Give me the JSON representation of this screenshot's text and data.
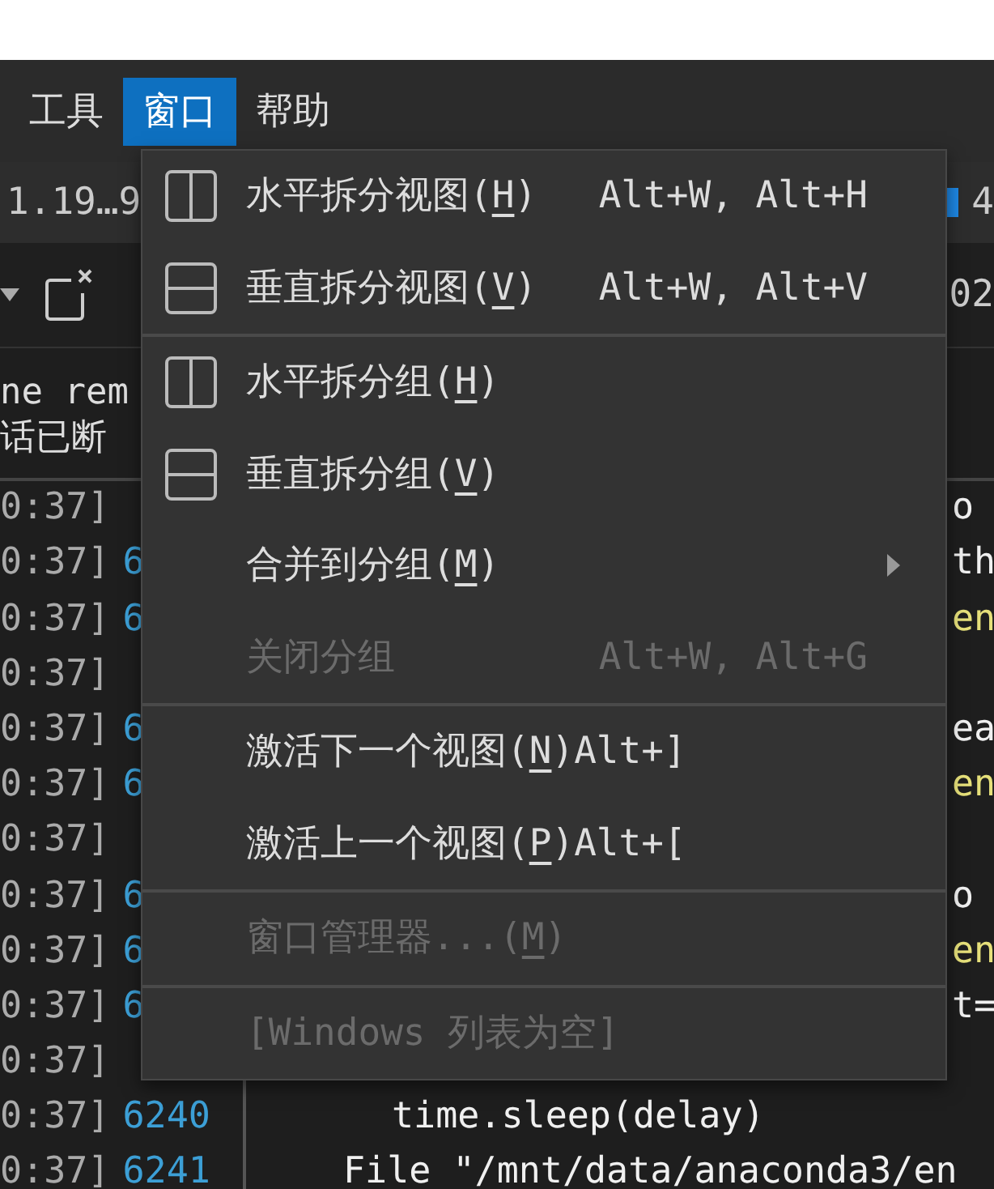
{
  "menubar": [
    {
      "label": "工具",
      "selected": false
    },
    {
      "label": "窗口",
      "selected": true
    },
    {
      "label": "帮助",
      "selected": false
    }
  ],
  "tab_bar": {
    "tab_text": "1.19…9",
    "right_text": "4"
  },
  "toolbar": {
    "right_text": "02"
  },
  "session_messages": [
    "ne rem",
    "话已断"
  ],
  "log_rows": [
    {
      "time": "0:37]"
    },
    {
      "time": "0:37]",
      "number": "6"
    },
    {
      "time": "0:37]",
      "number": "6"
    },
    {
      "time": "0:37]"
    },
    {
      "time": "0:37]",
      "number": "6"
    },
    {
      "time": "0:37]",
      "number": "6"
    },
    {
      "time": "0:37]"
    },
    {
      "time": "0:37]",
      "number": "6"
    },
    {
      "time": "0:37]",
      "number": "6"
    },
    {
      "time": "0:37]",
      "number": "6"
    },
    {
      "time": "0:37]"
    },
    {
      "time": "0:37]",
      "number": "6240"
    },
    {
      "time": "0:37]",
      "number": "6241"
    }
  ],
  "code_lines": [
    {
      "kind": "tail",
      "text": "o"
    },
    {
      "kind": "tail",
      "text": "th"
    },
    {
      "kind": "tailstring",
      "text": "en"
    },
    {
      "kind": "blank"
    },
    {
      "kind": "tail",
      "text": "ea"
    },
    {
      "kind": "tailstring",
      "text": "en"
    },
    {
      "kind": "blank"
    },
    {
      "kind": "tail",
      "text": "o"
    },
    {
      "kind": "tailstring",
      "text": "en"
    },
    {
      "kind": "tail",
      "text": "t="
    },
    {
      "kind": "blank"
    },
    {
      "kind": "inner",
      "text": "time.sleep(delay)"
    },
    {
      "kind": "line",
      "text": "File \"/mnt/data/anaconda3/en"
    }
  ],
  "window_menu": {
    "groups": [
      [
        {
          "kind": "columns",
          "label": "水平拆分视图(",
          "mnemonic": "H",
          "label_end": ")",
          "shortcut": "Alt+W, Alt+H",
          "disabled": false,
          "submenu": false
        },
        {
          "kind": "rows",
          "label": "垂直拆分视图(",
          "mnemonic": "V",
          "label_end": ")",
          "shortcut": "Alt+W, Alt+V",
          "disabled": false,
          "submenu": false
        }
      ],
      [
        {
          "kind": "columns",
          "label": "水平拆分组(",
          "mnemonic": "H",
          "label_end": ")",
          "disabled": false,
          "submenu": false
        },
        {
          "kind": "rows",
          "label": "垂直拆分组(",
          "mnemonic": "V",
          "label_end": ")",
          "disabled": false,
          "submenu": false
        },
        {
          "kind": "plain",
          "label": "合并到分组(",
          "mnemonic": "M",
          "label_end": ")",
          "disabled": false,
          "submenu": true
        },
        {
          "kind": "plain",
          "label": "关闭分组",
          "shortcut": "Alt+W, Alt+G",
          "disabled": true,
          "submenu": false
        }
      ],
      [
        {
          "kind": "plain",
          "label": "激活下一个视图(",
          "mnemonic": "N",
          "label_end": ")Alt+]",
          "disabled": false,
          "submenu": false
        },
        {
          "kind": "plain",
          "label": "激活上一个视图(",
          "mnemonic": "P",
          "label_end": ")Alt+[",
          "disabled": false,
          "submenu": false
        }
      ],
      [
        {
          "kind": "plain",
          "label": "窗口管理器...(",
          "mnemonic": "M",
          "label_end": ")",
          "disabled": true,
          "submenu": false
        }
      ],
      [
        {
          "kind": "plain",
          "label": "[Windows 列表为空]",
          "disabled": true,
          "submenu": false
        }
      ]
    ]
  }
}
